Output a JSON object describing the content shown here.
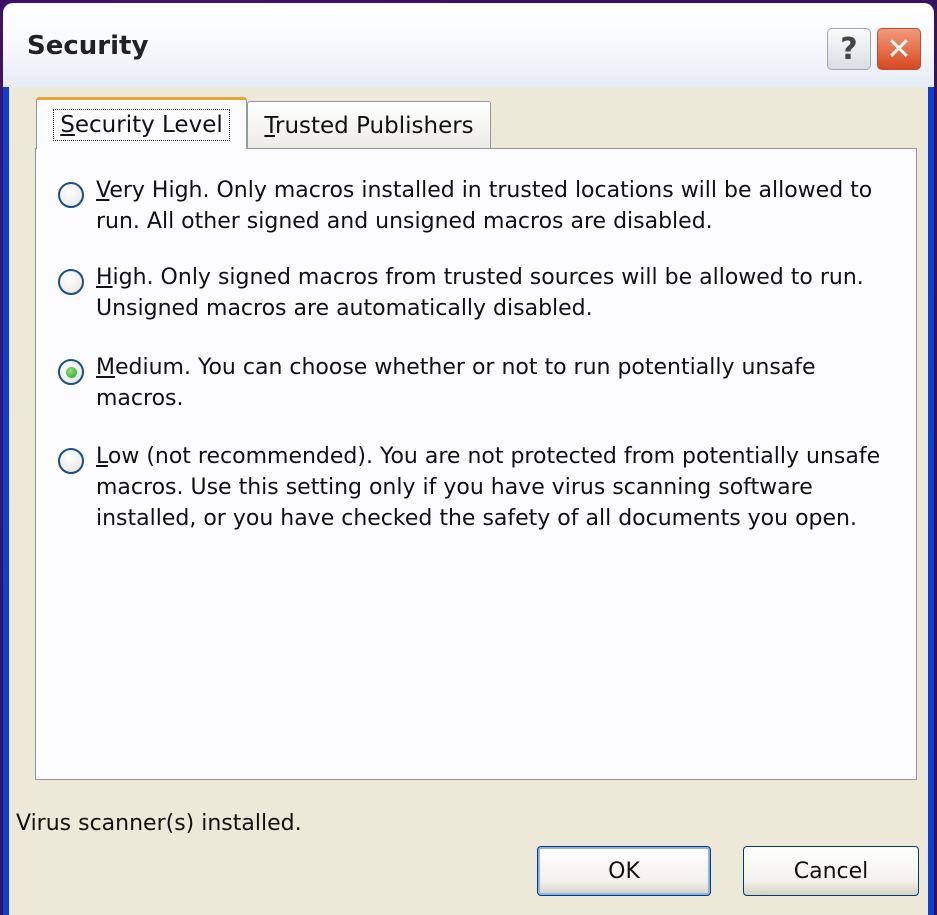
{
  "window": {
    "title": "Security",
    "help_glyph": "?",
    "close_glyph": "✕"
  },
  "tabs": [
    {
      "label": "Security Level",
      "accel": "S",
      "rest": "ecurity Level",
      "selected": true
    },
    {
      "label": "Trusted Publishers",
      "accel": "T",
      "rest": "rusted Publishers",
      "selected": false
    }
  ],
  "options": [
    {
      "accel": "V",
      "rest": "ery High. Only macros installed in trusted locations will be allowed to run. All other signed and unsigned macros are disabled.",
      "selected": false
    },
    {
      "accel": "H",
      "rest": "igh. Only signed macros from trusted sources will be allowed to run. Unsigned macros are automatically disabled.",
      "selected": false
    },
    {
      "accel": "M",
      "rest": "edium. You can choose whether or not to run potentially unsafe macros.",
      "selected": true
    },
    {
      "accel": "L",
      "rest": "ow (not recommended). You are not protected from potentially unsafe macros. Use this setting only if you have virus scanning software installed, or you have checked the safety of all documents you open.",
      "selected": false
    }
  ],
  "status_text": "Virus scanner(s) installed.",
  "buttons": {
    "ok": "OK",
    "cancel": "Cancel"
  },
  "icons": {
    "help": "help-icon",
    "close": "close-icon",
    "radio_selected": "radio-selected-icon",
    "radio_empty": "radio-empty-icon"
  },
  "colors": {
    "titlebar_frame": "#0b3fd6",
    "close_button": "#d8481f",
    "tab_highlight": "#e8a530",
    "radio_dot": "#21a121",
    "dialog_face": "#ece9d8"
  }
}
